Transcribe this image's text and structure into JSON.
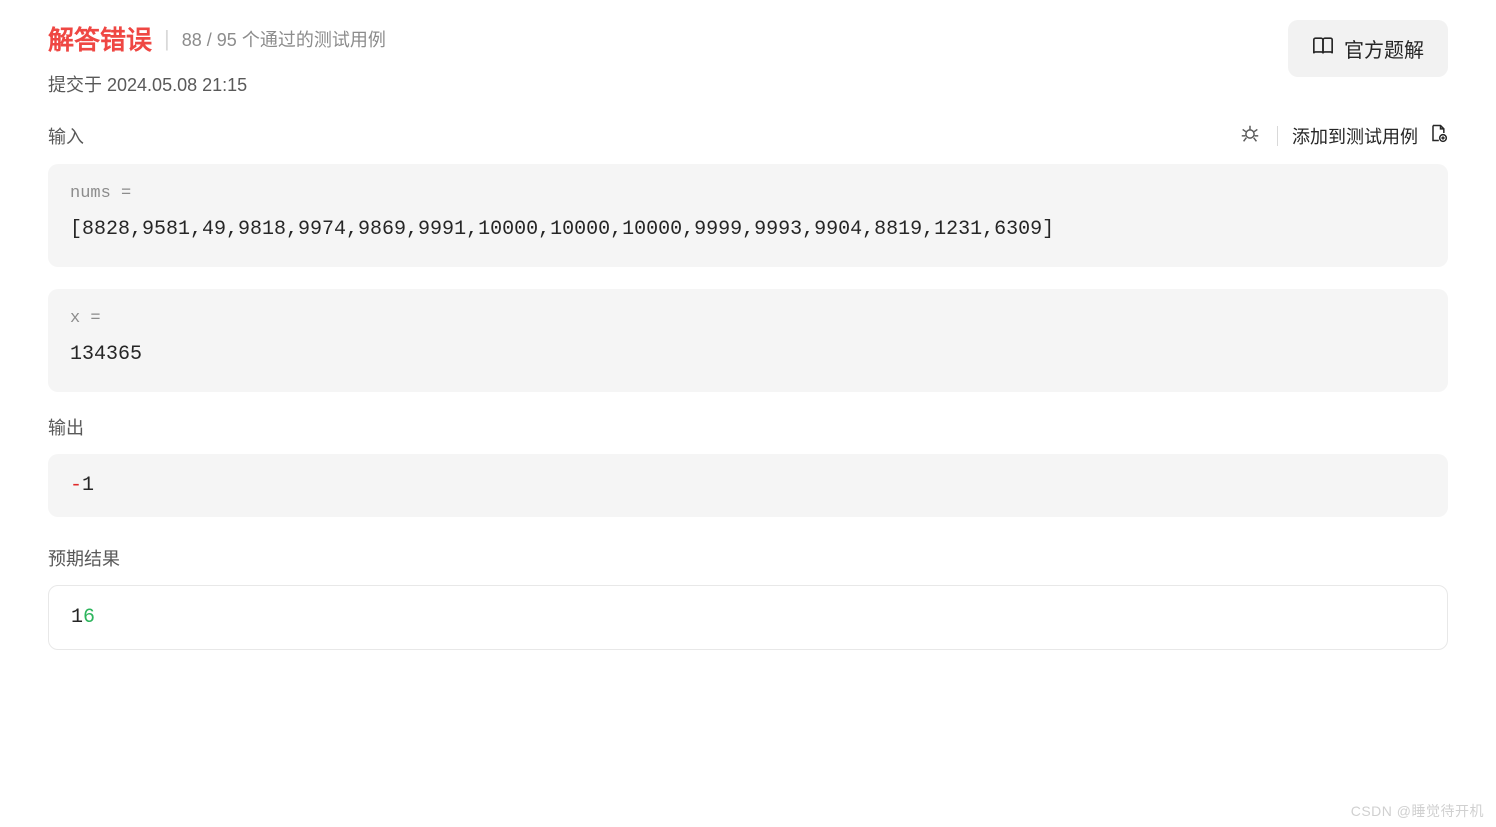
{
  "header": {
    "status_title": "解答错误",
    "passed": "88",
    "total": "95",
    "test_suffix": "个通过的测试用例",
    "submit_prefix": "提交于",
    "submit_time": "2024.05.08 21:15",
    "solution_button": "官方题解"
  },
  "input": {
    "label": "输入",
    "add_test": "添加到测试用例",
    "param1_label": "nums =",
    "param1_value": "[8828,9581,49,9818,9974,9869,9991,10000,10000,10000,9999,9993,9904,8819,1231,6309]",
    "param2_label": "x =",
    "param2_value": "134365"
  },
  "output": {
    "label": "输出",
    "value_wrong": "-",
    "value_same": "1"
  },
  "expected": {
    "label": "预期结果",
    "value_same": "1",
    "value_right": "6"
  },
  "watermark": "CSDN @睡觉待开机"
}
